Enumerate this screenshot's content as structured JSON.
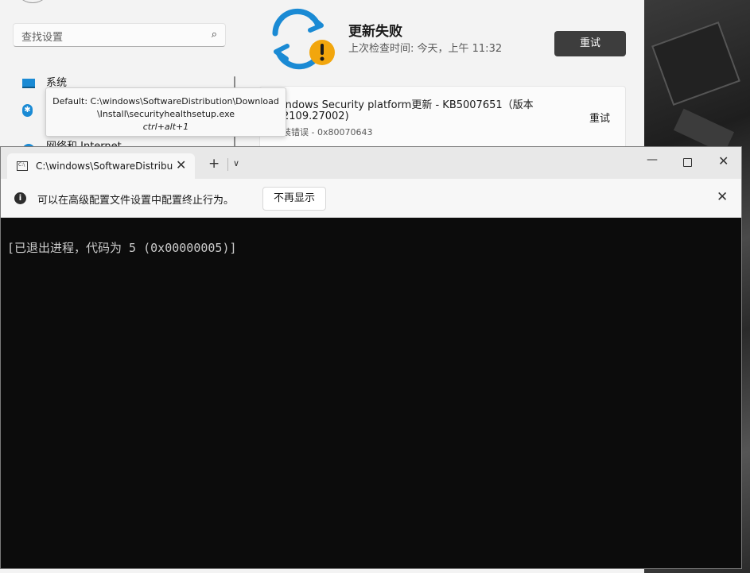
{
  "settings": {
    "search_placeholder": "查找设置",
    "nav": [
      "系统",
      "网络和 Internet"
    ],
    "update": {
      "status_title": "更新失败",
      "last_checked": "上次检查时间: 今天，上午 11:32",
      "retry_label": "重试",
      "item_line1": "indows Security platform更新 - KB5007651（版本",
      "item_line2": "2109.27002)",
      "item_error": "装错误 - 0x80070643",
      "item_retry_label": "重试"
    }
  },
  "tooltip": {
    "line1": "Default: C:\\windows\\SoftwareDistribution\\Download",
    "line2": "\\Install\\securityhealthsetup.exe",
    "shortcut": "ctrl+alt+1"
  },
  "terminal": {
    "tab_title": "C:\\windows\\SoftwareDistribu",
    "new_tab_icon": "plus-icon",
    "infobar": {
      "message": "可以在高级配置文件设置中配置终止行为。",
      "dismiss_label": "不再显示"
    },
    "output": "[已退出进程，代码为 5 (0x00000005)]"
  },
  "colors": {
    "accent_blue": "#1a8ad4",
    "warning_orange": "#f2a60d",
    "terminal_bg": "#0c0c0c",
    "terminal_text": "#cccccc"
  }
}
